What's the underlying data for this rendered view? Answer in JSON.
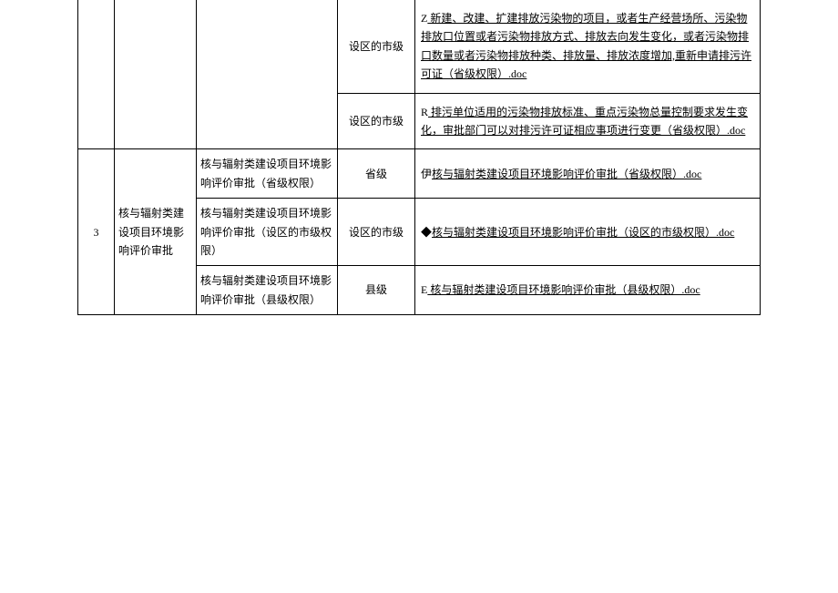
{
  "rows": [
    {
      "num": "",
      "category": "",
      "subcategory": "",
      "level": "设区的市级",
      "marker": "Z",
      "link": " 新建、改建、扩建排放污染物的项目，或者生产经营场所、污染物排放口位置或者污染物排放方式、排放去向发生变化，或者污染物排口数量或者污染物排放种类、排放量、排放浓度增加,重新申请排污许可证（省级权限）.doc"
    },
    {
      "num": "",
      "category": "",
      "subcategory": "",
      "level": "设区的市级",
      "marker": "R",
      "link": " 排污单位适用的污染物排放标准、重点污染物总量控制要求发生变化，审批部门可以对排污许可证相应事项进行变更（省级权限）.doc"
    },
    {
      "num": "3",
      "category": "核与辐射类建设项目环境影响评价审批",
      "sub1": "核与辐射类建设项目环境影响评价审批（省级权限）",
      "level1": "省级",
      "marker1": "伊",
      "link1": "核与辐射类建设项目环境影响评价审批（省级权限）.doc",
      "sub2": "核与辐射类建设项目环境影响评价审批（设区的市级权限）",
      "level2": "设区的市级",
      "marker2": "◆",
      "link2": "核与辐射类建设项目环境影响评价审批（设区的市级权限）.doc",
      "sub3": "核与辐射类建设项目环境影响评价审批（县级权限）",
      "level3": "县级",
      "marker3": "E",
      "link3": " 核与辐射类建设项目环境影响评价审批（县级权限）.doc"
    }
  ]
}
